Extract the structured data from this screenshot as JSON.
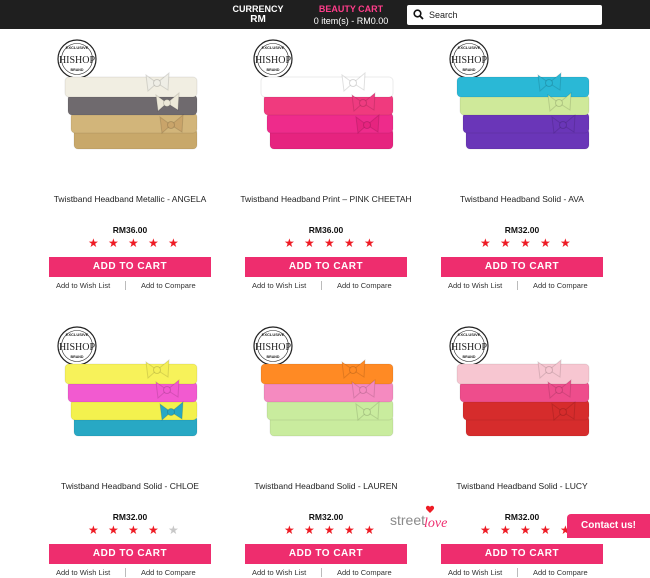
{
  "header": {
    "currency_label": "CURRENCY",
    "currency_value": "RM",
    "cart_label": "BEAUTY CART",
    "cart_summary": "0 item(s) - RM0.00",
    "search_placeholder": "Search"
  },
  "brand_badge": {
    "arc_text": "EXCLUSIVE",
    "name": "HISHOP",
    "sub": "BRAND"
  },
  "products": [
    {
      "title": "Twistband Headband Metallic - ANGELA",
      "price": "RM36.00",
      "rating": 5,
      "colors": [
        "#f1eee2",
        "#6f6a6e",
        "#d2b57a",
        "#c8a86a"
      ],
      "bows": [
        "#efeee6",
        "#ece8d8",
        "#c9a46a"
      ]
    },
    {
      "title": "Twistband Headband Print – PINK CHEETAH",
      "price": "RM36.00",
      "rating": 5,
      "colors": [
        "#ffffff",
        "#f03a7e",
        "#ee2b8b",
        "#e6237f"
      ],
      "bows": [
        "#ffffff",
        "#ef3b80",
        "#e6247f"
      ]
    },
    {
      "title": "Twistband Headband Solid - AVA",
      "price": "RM32.00",
      "rating": 5,
      "colors": [
        "#2ab8d6",
        "#cfe99a",
        "#6a36b8",
        "#6a36b8"
      ],
      "bows": [
        "#2ab8d6",
        "#cfe99a",
        "#6a36b8"
      ]
    },
    {
      "title": "Twistband Headband Solid - CHLOE",
      "price": "RM32.00",
      "rating": 4,
      "colors": [
        "#f7f25a",
        "#f25ad0",
        "#f3f14e",
        "#28a8c4"
      ],
      "bows": [
        "#f4ef58",
        "#f25ad0",
        "#28a8c4"
      ]
    },
    {
      "title": "Twistband Headband Solid - LAUREN",
      "price": "RM32.00",
      "rating": 5,
      "colors": [
        "#ff8a24",
        "#f58ac0",
        "#c9ec9e",
        "#c9ec9e"
      ],
      "bows": [
        "#ff8a24",
        "#f58ac0",
        "#c9ec9e"
      ]
    },
    {
      "title": "Twistband Headband Solid - LUCY",
      "price": "RM32.00",
      "rating": 5,
      "colors": [
        "#f7c6d1",
        "#ee4d8c",
        "#d62c2c",
        "#d62c2c"
      ],
      "bows": [
        "#f7c6d1",
        "#ee4d8c",
        "#d62c2c"
      ]
    }
  ],
  "labels": {
    "add_to_cart": "ADD TO CART",
    "wish_list": "Add to Wish List",
    "compare": "Add to Compare"
  },
  "watermark": {
    "line1": "street",
    "line2": "love"
  },
  "contact_button": "Contact us!"
}
